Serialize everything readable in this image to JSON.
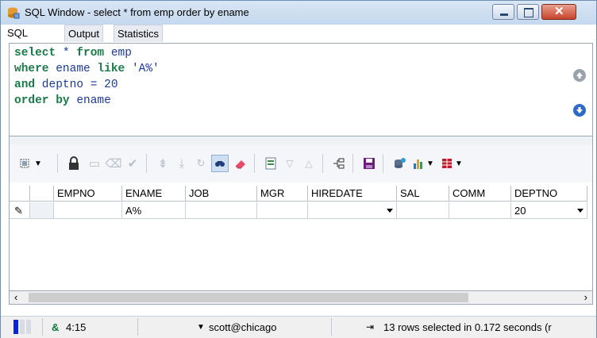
{
  "window": {
    "title": "SQL Window - select * from emp order by ename"
  },
  "tabs": [
    {
      "label": "SQL"
    },
    {
      "label": "Output"
    },
    {
      "label": "Statistics"
    }
  ],
  "sql": {
    "line1": {
      "kw1": "select",
      "mid": " * ",
      "kw2": "from",
      "id": " emp"
    },
    "line2": {
      "kw1": "where",
      "id": " ename ",
      "kw2": "like",
      "str": " 'A%'"
    },
    "line3": {
      "kw1": "and",
      "id": " deptno = ",
      "num": "20"
    },
    "line4": {
      "kw1": "order by",
      "id": " ename"
    }
  },
  "grid": {
    "columns": [
      "EMPNO",
      "ENAME",
      "JOB",
      "MGR",
      "HIREDATE",
      "SAL",
      "COMM",
      "DEPTNO"
    ],
    "row": {
      "EMPNO": "",
      "ENAME": "A%",
      "JOB": "",
      "MGR": "",
      "HIREDATE": "",
      "SAL": "",
      "COMM": "",
      "DEPTNO": "20"
    }
  },
  "status": {
    "position": "4:15",
    "connection": "scott@chicago",
    "message": "13 rows selected in 0.172 seconds (r"
  },
  "colors": {
    "keyword": "#1a7a4a",
    "identifier": "#1d3a9b",
    "title_bar": "#c5d8ee",
    "close_button": "#c7432b"
  }
}
